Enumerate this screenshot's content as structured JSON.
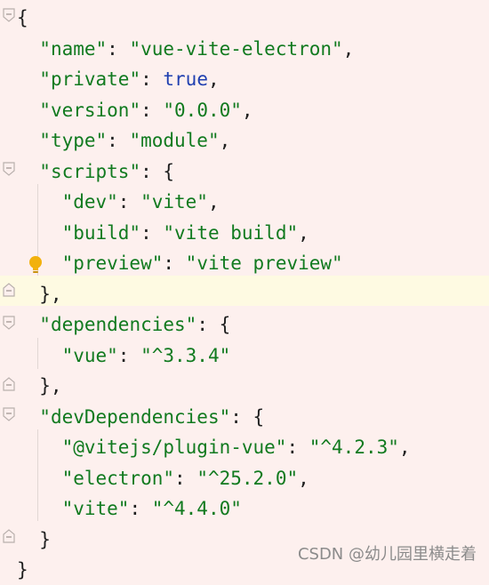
{
  "editor": {
    "lines": [
      {
        "parts": [
          {
            "t": "{",
            "c": "punct"
          }
        ]
      },
      {
        "parts": [
          {
            "t": "  ",
            "c": "punct"
          },
          {
            "t": "\"name\"",
            "c": "key"
          },
          {
            "t": ": ",
            "c": "punct"
          },
          {
            "t": "\"vue-vite-electron\"",
            "c": "str"
          },
          {
            "t": ",",
            "c": "punct"
          }
        ]
      },
      {
        "parts": [
          {
            "t": "  ",
            "c": "punct"
          },
          {
            "t": "\"private\"",
            "c": "key"
          },
          {
            "t": ": ",
            "c": "punct"
          },
          {
            "t": "true",
            "c": "kw"
          },
          {
            "t": ",",
            "c": "punct"
          }
        ]
      },
      {
        "parts": [
          {
            "t": "  ",
            "c": "punct"
          },
          {
            "t": "\"version\"",
            "c": "key"
          },
          {
            "t": ": ",
            "c": "punct"
          },
          {
            "t": "\"0.0.0\"",
            "c": "str"
          },
          {
            "t": ",",
            "c": "punct"
          }
        ]
      },
      {
        "parts": [
          {
            "t": "  ",
            "c": "punct"
          },
          {
            "t": "\"type\"",
            "c": "key"
          },
          {
            "t": ": ",
            "c": "punct"
          },
          {
            "t": "\"module\"",
            "c": "str"
          },
          {
            "t": ",",
            "c": "punct"
          }
        ]
      },
      {
        "parts": [
          {
            "t": "  ",
            "c": "punct"
          },
          {
            "t": "\"scripts\"",
            "c": "key"
          },
          {
            "t": ": {",
            "c": "punct"
          }
        ]
      },
      {
        "parts": [
          {
            "t": "    ",
            "c": "punct"
          },
          {
            "t": "\"dev\"",
            "c": "key"
          },
          {
            "t": ": ",
            "c": "punct"
          },
          {
            "t": "\"vite\"",
            "c": "str"
          },
          {
            "t": ",",
            "c": "punct"
          }
        ]
      },
      {
        "parts": [
          {
            "t": "    ",
            "c": "punct"
          },
          {
            "t": "\"build\"",
            "c": "key"
          },
          {
            "t": ": ",
            "c": "punct"
          },
          {
            "t": "\"vite build\"",
            "c": "str"
          },
          {
            "t": ",",
            "c": "punct"
          }
        ]
      },
      {
        "parts": [
          {
            "t": "    ",
            "c": "punct"
          },
          {
            "t": "\"preview\"",
            "c": "key"
          },
          {
            "t": ": ",
            "c": "punct"
          },
          {
            "t": "\"vite preview\"",
            "c": "str"
          }
        ]
      },
      {
        "parts": [
          {
            "t": "  },",
            "c": "punct"
          }
        ]
      },
      {
        "parts": [
          {
            "t": "  ",
            "c": "punct"
          },
          {
            "t": "\"dependencies\"",
            "c": "key"
          },
          {
            "t": ": {",
            "c": "punct"
          }
        ]
      },
      {
        "parts": [
          {
            "t": "    ",
            "c": "punct"
          },
          {
            "t": "\"vue\"",
            "c": "key"
          },
          {
            "t": ": ",
            "c": "punct"
          },
          {
            "t": "\"^3.3.4\"",
            "c": "str"
          }
        ]
      },
      {
        "parts": [
          {
            "t": "  },",
            "c": "punct"
          }
        ]
      },
      {
        "parts": [
          {
            "t": "  ",
            "c": "punct"
          },
          {
            "t": "\"devDependencies\"",
            "c": "key"
          },
          {
            "t": ": {",
            "c": "punct"
          }
        ]
      },
      {
        "parts": [
          {
            "t": "    ",
            "c": "punct"
          },
          {
            "t": "\"@vitejs/plugin-vue\"",
            "c": "key"
          },
          {
            "t": ": ",
            "c": "punct"
          },
          {
            "t": "\"^4.2.3\"",
            "c": "str"
          },
          {
            "t": ",",
            "c": "punct"
          }
        ]
      },
      {
        "parts": [
          {
            "t": "    ",
            "c": "punct"
          },
          {
            "t": "\"electron\"",
            "c": "key"
          },
          {
            "t": ": ",
            "c": "punct"
          },
          {
            "t": "\"^25.2.0\"",
            "c": "str"
          },
          {
            "t": ",",
            "c": "punct"
          }
        ]
      },
      {
        "parts": [
          {
            "t": "    ",
            "c": "punct"
          },
          {
            "t": "\"vite\"",
            "c": "key"
          },
          {
            "t": ": ",
            "c": "punct"
          },
          {
            "t": "\"^4.4.0\"",
            "c": "str"
          }
        ]
      },
      {
        "parts": [
          {
            "t": "  }",
            "c": "punct"
          }
        ]
      },
      {
        "parts": [
          {
            "t": "}",
            "c": "punct"
          }
        ]
      }
    ]
  },
  "watermark": "CSDN @幼儿园里横走着",
  "icons": {
    "intention": "lightbulb-icon",
    "fold_open": "fold-open-icon",
    "fold_close": "fold-close-icon"
  },
  "colors": {
    "background": "#fdf0ee",
    "current_line": "#fefae2",
    "string": "#117a1f",
    "keyword": "#1f3fb0"
  }
}
